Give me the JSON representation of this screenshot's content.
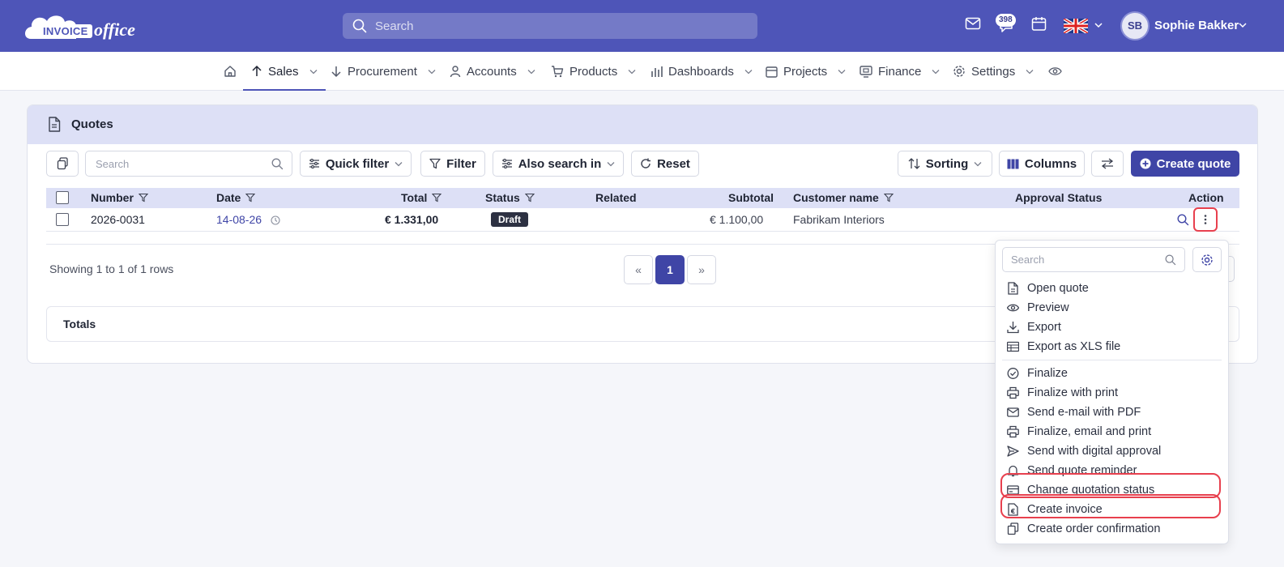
{
  "topbar": {
    "logo_invoice": "INVOICE",
    "logo_office": "office",
    "search_placeholder": "Search",
    "notification_count": "398",
    "user_initials": "SB",
    "user_name": "Sophie Bakker",
    "language_flag": "uk-flag-icon"
  },
  "nav": {
    "items": [
      {
        "label": "Sales",
        "icon": "arrow-up-icon",
        "active": true
      },
      {
        "label": "Procurement",
        "icon": "arrow-down-icon"
      },
      {
        "label": "Accounts",
        "icon": "user-icon"
      },
      {
        "label": "Products",
        "icon": "cart-icon"
      },
      {
        "label": "Dashboards",
        "icon": "bar-chart-icon"
      },
      {
        "label": "Projects",
        "icon": "calendar-icon"
      },
      {
        "label": "Finance",
        "icon": "finance-icon"
      },
      {
        "label": "Settings",
        "icon": "gear-icon"
      }
    ]
  },
  "card": {
    "title": "Quotes"
  },
  "toolbar": {
    "search_placeholder": "Search",
    "quick_filter": "Quick filter",
    "filter": "Filter",
    "also_search_in": "Also search in",
    "reset": "Reset",
    "sorting": "Sorting",
    "columns": "Columns",
    "create_quote": "Create quote"
  },
  "table": {
    "columns": [
      "Number",
      "Date",
      "Total",
      "Status",
      "Related",
      "Subtotal",
      "Customer name",
      "Approval Status",
      "Action"
    ],
    "rows": [
      {
        "number": "2026-0031",
        "date": "14-08-26",
        "total": "€ 1.331,00",
        "status": "Draft",
        "related": "",
        "subtotal": "€ 1.100,00",
        "customer": "Fabrikam Interiors",
        "approval": ""
      }
    ]
  },
  "pagination": {
    "showing": "Showing 1 to 1 of 1 rows",
    "prev": "«",
    "current": "1",
    "next": "»"
  },
  "totals": {
    "label": "Totals"
  },
  "action_menu": {
    "search_placeholder": "Search",
    "group1": [
      {
        "label": "Open quote",
        "icon": "document-icon"
      },
      {
        "label": "Preview",
        "icon": "eye-icon"
      },
      {
        "label": "Export",
        "icon": "download-icon"
      },
      {
        "label": "Export as XLS file",
        "icon": "spreadsheet-icon"
      }
    ],
    "group2": [
      {
        "label": "Finalize",
        "icon": "check-circle-icon"
      },
      {
        "label": "Finalize with print",
        "icon": "printer-icon"
      },
      {
        "label": "Send e-mail with PDF",
        "icon": "mail-icon"
      },
      {
        "label": "Finalize, email and print",
        "icon": "printer-icon"
      },
      {
        "label": "Send with digital approval",
        "icon": "send-icon"
      },
      {
        "label": "Send quote reminder",
        "icon": "bell-icon"
      },
      {
        "label": "Change quotation status",
        "icon": "card-icon"
      },
      {
        "label": "Create invoice",
        "icon": "euro-document-icon"
      },
      {
        "label": "Create order confirmation",
        "icon": "copy-document-icon"
      }
    ]
  },
  "colors": {
    "brand": "#4e55b8",
    "primary_button": "#3f45a6",
    "header_tint": "#dde0f6",
    "highlight": "#e8404e"
  }
}
